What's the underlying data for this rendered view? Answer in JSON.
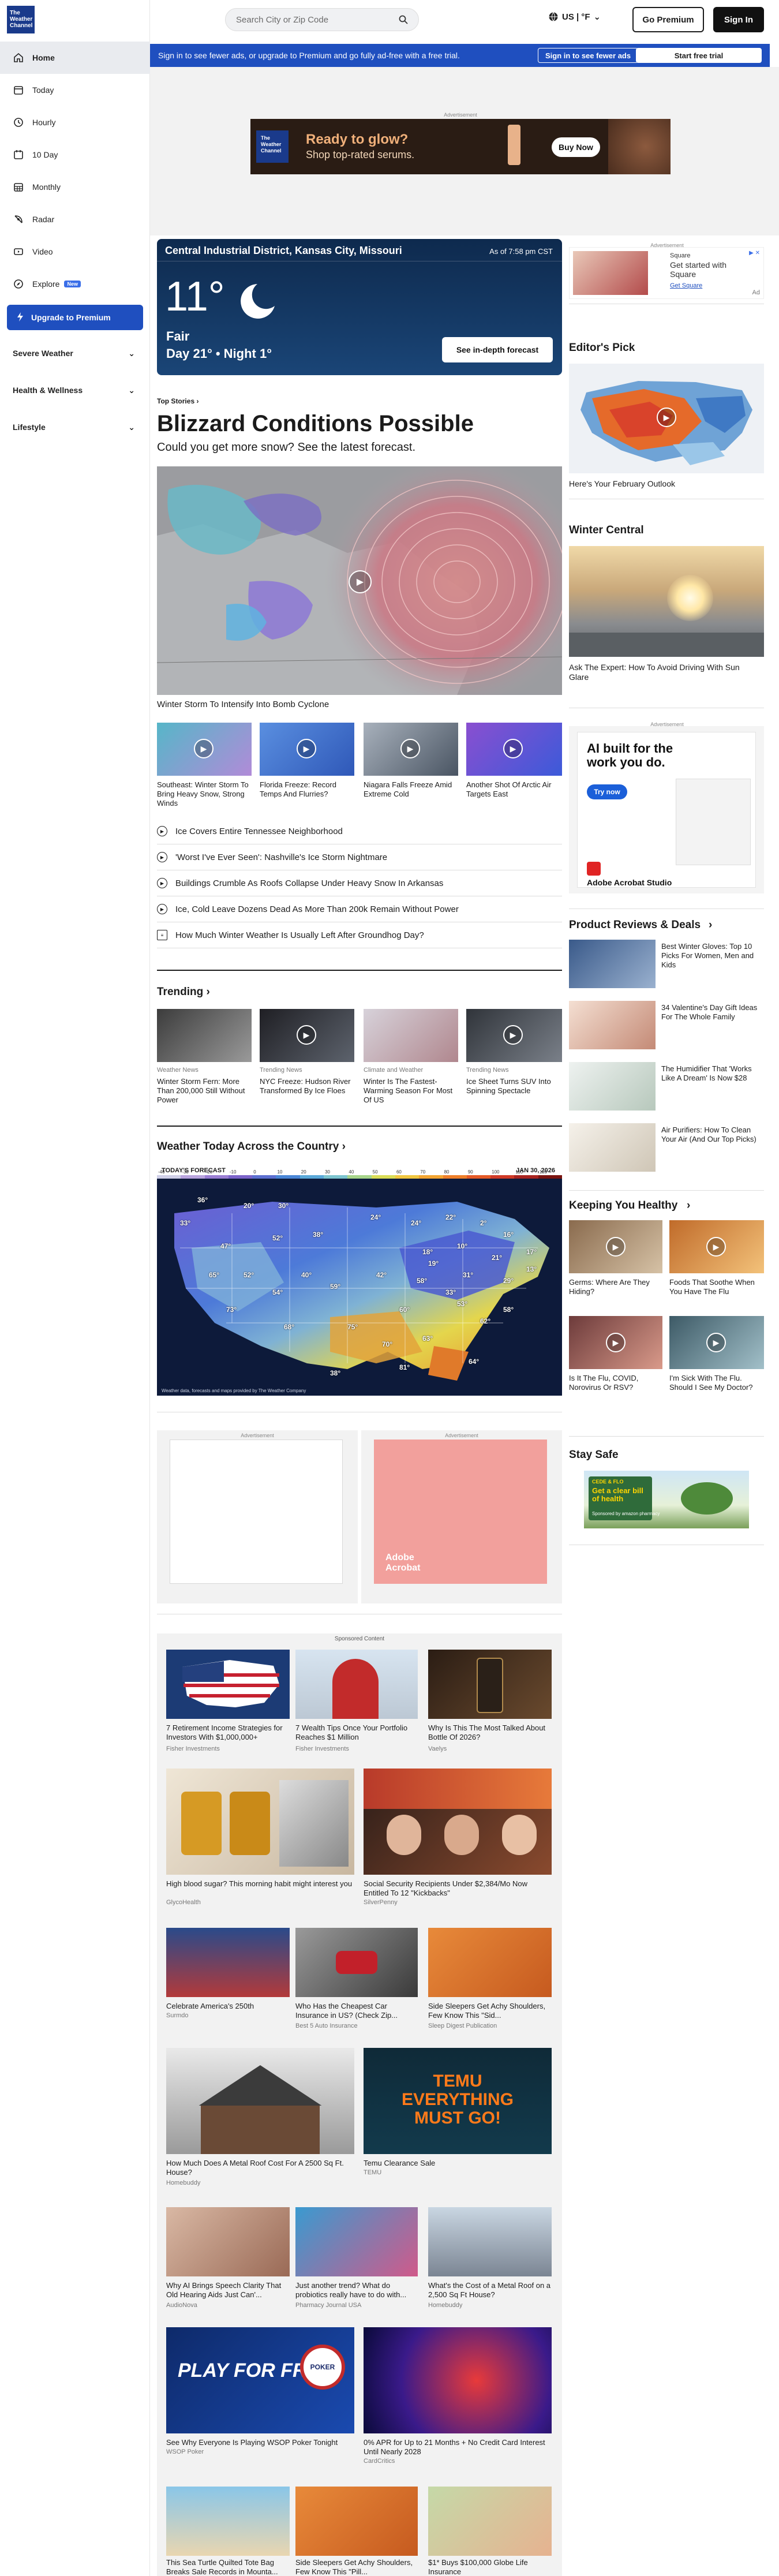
{
  "brand": {
    "logo_text": "The Weather Channel"
  },
  "header": {
    "search_placeholder": "Search City or Zip Code",
    "unit": "US | °F",
    "go_premium": "Go Premium",
    "sign_in": "Sign In"
  },
  "banner": {
    "text": "Sign in to see fewer ads, or upgrade to Premium and go fully ad-free with a free trial.",
    "btn_sign_in": "Sign in to see fewer ads",
    "btn_trial": "Start free trial"
  },
  "sidebar": {
    "items": [
      {
        "label": "Home",
        "icon": "home-icon"
      },
      {
        "label": "Today",
        "icon": "today-icon"
      },
      {
        "label": "Hourly",
        "icon": "clock-icon"
      },
      {
        "label": "10 Day",
        "icon": "calendar-icon"
      },
      {
        "label": "Monthly",
        "icon": "calendar-grid-icon"
      },
      {
        "label": "Radar",
        "icon": "radar-icon"
      },
      {
        "label": "Video",
        "icon": "video-icon"
      },
      {
        "label": "Explore",
        "icon": "explore-icon",
        "badge": "New"
      }
    ],
    "premium": "Upgrade to Premium",
    "groups": [
      "Severe Weather",
      "Health & Wellness",
      "Lifestyle"
    ]
  },
  "ads": {
    "label": "Advertisement",
    "top": {
      "headline": "Ready to glow?",
      "sub": "Shop top-rated serums.",
      "cta": "Buy Now",
      "logo": "The Weather Channel"
    },
    "square": {
      "brand": "Square",
      "text": "Get started with Square",
      "link": "Get Square",
      "tag": "Ad"
    },
    "adobe": {
      "headline": "AI built for the work you do.",
      "cta": "Try now",
      "product": "Adobe Acrobat Studio",
      "product2": "Adobe Acrobat"
    },
    "amazon": {
      "text": "Get a clear bill of health",
      "tag": "CEDE & FLO",
      "sponsored": "Sponsored by amazon pharmacy"
    }
  },
  "current": {
    "location": "Central Industrial District, Kansas City, Missouri",
    "as_of": "As of 7:58 pm CST",
    "temp": "11°",
    "condition": "Fair",
    "hilo": "Day 21° • Night 1°",
    "cta": "See in-depth forecast"
  },
  "top_stories": {
    "label": "Top Stories",
    "headline": "Blizzard Conditions Possible",
    "sub": "Could you get more snow? See the latest forecast.",
    "hero_caption": "Winter Storm To Intensify Into Bomb Cyclone",
    "thumbs": [
      "Southeast: Winter Storm To Bring Heavy Snow, Strong Winds",
      "Florida Freeze: Record Temps And Flurries?",
      "Niagara Falls Freeze Amid Extreme Cold",
      "Another Shot Of Arctic Air Targets East"
    ],
    "list": [
      {
        "text": "Ice Covers Entire Tennessee Neighborhood",
        "icon": "play-icon"
      },
      {
        "text": "'Worst I've Ever Seen': Nashville's Ice Storm Nightmare",
        "icon": "play-icon"
      },
      {
        "text": "Buildings Crumble As Roofs Collapse Under Heavy Snow In Arkansas",
        "icon": "play-icon"
      },
      {
        "text": "Ice, Cold Leave Dozens Dead As More Than 200k Remain Without Power",
        "icon": "play-icon"
      },
      {
        "text": "How Much Winter Weather Is Usually Left After Groundhog Day?",
        "icon": "article-icon"
      }
    ]
  },
  "trending": {
    "title": "Trending",
    "items": [
      {
        "meta": "Weather News",
        "text": "Winter Storm Fern: More Than 200,000 Still Without Power"
      },
      {
        "meta": "Trending News",
        "text": "NYC Freeze: Hudson River Transformed By Ice Floes"
      },
      {
        "meta": "Climate and Weather",
        "text": "Winter Is The Fastest-Warming Season For Most Of US"
      },
      {
        "meta": "Trending News",
        "text": "Ice Sheet Turns SUV Into Spinning Spectacle"
      }
    ]
  },
  "country": {
    "title": "Weather Today Across the Country",
    "map_label": "TODAY'S FORECAST",
    "date": "JAN 30, 2026",
    "scale": [
      "-40",
      "-30",
      "-20",
      "-10",
      "0",
      "10",
      "20",
      "30",
      "40",
      "50",
      "60",
      "70",
      "80",
      "90",
      "100",
      "110",
      "120"
    ],
    "temps": [
      "36°",
      "33°",
      "20°",
      "30°",
      "47°",
      "52°",
      "38°",
      "24°",
      "24°",
      "22°",
      "2°",
      "16°",
      "18°",
      "10°",
      "21°",
      "17°",
      "65°",
      "52°",
      "40°",
      "73°",
      "54°",
      "59°",
      "42°",
      "58°",
      "31°",
      "29°",
      "13°",
      "19°",
      "68°",
      "75°",
      "60°",
      "53°",
      "70°",
      "63°",
      "62°",
      "58°",
      "33°",
      "81°",
      "38°",
      "64°"
    ],
    "footer": "Weather data, forecasts and maps provided by The Weather Company"
  },
  "right": {
    "editors_pick": {
      "title": "Editor's Pick",
      "caption": "Here's Your February Outlook"
    },
    "winter_central": {
      "title": "Winter Central",
      "caption": "Ask The Expert: How To Avoid Driving With Sun Glare"
    },
    "product_reviews": {
      "title": "Product Reviews & Deals",
      "items": [
        "Best Winter Gloves: Top 10 Picks For Women, Men and Kids",
        "34 Valentine's Day Gift Ideas For The Whole Family",
        "The Humidifier That 'Works Like A Dream' Is Now $28",
        "Air Purifiers: How To Clean Your Air (And Our Top Picks)"
      ]
    },
    "keeping_healthy": {
      "title": "Keeping You Healthy",
      "items": [
        "Germs: Where Are They Hiding?",
        "Foods That Soothe When You Have The Flu",
        "Is It The Flu, COVID, Norovirus Or RSV?",
        "I'm Sick With The Flu. Should I See My Doctor?"
      ]
    },
    "stay_safe": {
      "title": "Stay Safe"
    }
  },
  "sponsored": {
    "label": "Sponsored Content",
    "items": [
      {
        "text": "7 Retirement Income Strategies for Investors With $1,000,000+",
        "src": "Fisher Investments"
      },
      {
        "text": "7 Wealth Tips Once Your Portfolio Reaches $1 Million",
        "src": "Fisher Investments"
      },
      {
        "text": "Why Is This The Most Talked About Bottle Of 2026?",
        "src": "Vaelys"
      },
      {
        "text": "High blood sugar? This morning habit might interest you",
        "src": "GlycoHealth"
      },
      {
        "text": "Social Security Recipients Under $2,384/Mo Now Entitled To 12 \"Kickbacks\"",
        "src": "SilverPenny"
      },
      {
        "text": "Celebrate America's 250th",
        "src": "Surmdo"
      },
      {
        "text": "Who Has the Cheapest Car Insurance in US? (Check Zip...",
        "src": "Best 5 Auto Insurance"
      },
      {
        "text": "Side Sleepers Get Achy Shoulders, Few Know This \"Sid...",
        "src": "Sleep Digest Publication"
      },
      {
        "text": "How Much Does A Metal Roof Cost For A 2500 Sq Ft. House?",
        "src": "Homebuddy"
      },
      {
        "text": "Temu Clearance Sale",
        "src": "TEMU"
      },
      {
        "text": "Why AI Brings Speech Clarity That Old Hearing Aids Just Can'...",
        "src": "AudioNova"
      },
      {
        "text": "Just another trend? What do probiotics really have to do with...",
        "src": "Pharmacy Journal USA"
      },
      {
        "text": "What's the Cost of a Metal Roof on a 2,500 Sq Ft House?",
        "src": "Homebuddy"
      },
      {
        "text": "See Why Everyone Is Playing WSOP Poker Tonight",
        "src": "WSOP Poker"
      },
      {
        "text": "0% APR for Up to 21 Months + No Credit Card Interest Until Nearly 2028",
        "src": "CardCritics"
      },
      {
        "text": "This Sea Turtle Quilted Tote Bag Breaks Sale Records in Mounta...",
        "src": ""
      },
      {
        "text": "Side Sleepers Get Achy Shoulders, Few Know This \"Pill...",
        "src": ""
      },
      {
        "text": "$1* Buys $100,000 Globe Life Insurance",
        "src": ""
      }
    ],
    "play_for_free": "PLAY FOR FREE",
    "temu_line": "TEMU EVERYTHING MUST GO!",
    "poker": "POKER"
  }
}
